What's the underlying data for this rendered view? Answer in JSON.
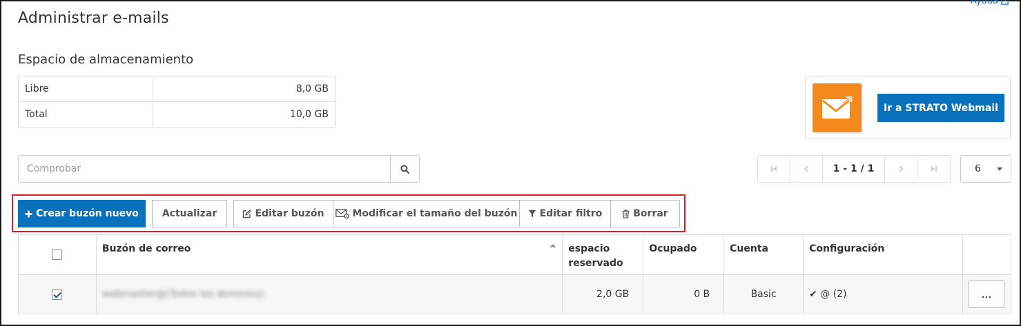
{
  "header": {
    "title": "Administrar e-mails",
    "help_label": "Ayuda"
  },
  "storage": {
    "title": "Espacio de almacenamiento",
    "rows": [
      {
        "label": "Libre",
        "value": "8,0 GB"
      },
      {
        "label": "Total",
        "value": "10,0 GB"
      }
    ]
  },
  "webmail": {
    "button_label": "Ir a STRATO Webmail",
    "icon": "envelope-icon",
    "icon_color": "#f48a1c"
  },
  "search": {
    "placeholder": "Comprobar",
    "value": ""
  },
  "pagination": {
    "info": "1 - 1 / 1",
    "per_page": "6"
  },
  "toolbar": {
    "create_label": "Crear buzón nuevo",
    "refresh_label": "Actualizar",
    "edit_label": "Editar buzón",
    "resize_label": "Modificar el tamaño del buzón",
    "filter_label": "Editar filtro",
    "delete_label": "Borrar"
  },
  "table": {
    "columns": [
      "Buzón de correo",
      "espacio reservado",
      "Ocupado",
      "Cuenta",
      "Configuración"
    ],
    "rows": [
      {
        "checked": true,
        "mailbox": "webmaster@(Todos los dominios)",
        "reserved": "2,0 GB",
        "used": "0 B",
        "account": "Basic",
        "config": "@ (2)",
        "more": "..."
      }
    ]
  },
  "colors": {
    "primary": "#0a72bd",
    "highlight": "#d71f26",
    "accent_orange": "#f48a1c"
  }
}
